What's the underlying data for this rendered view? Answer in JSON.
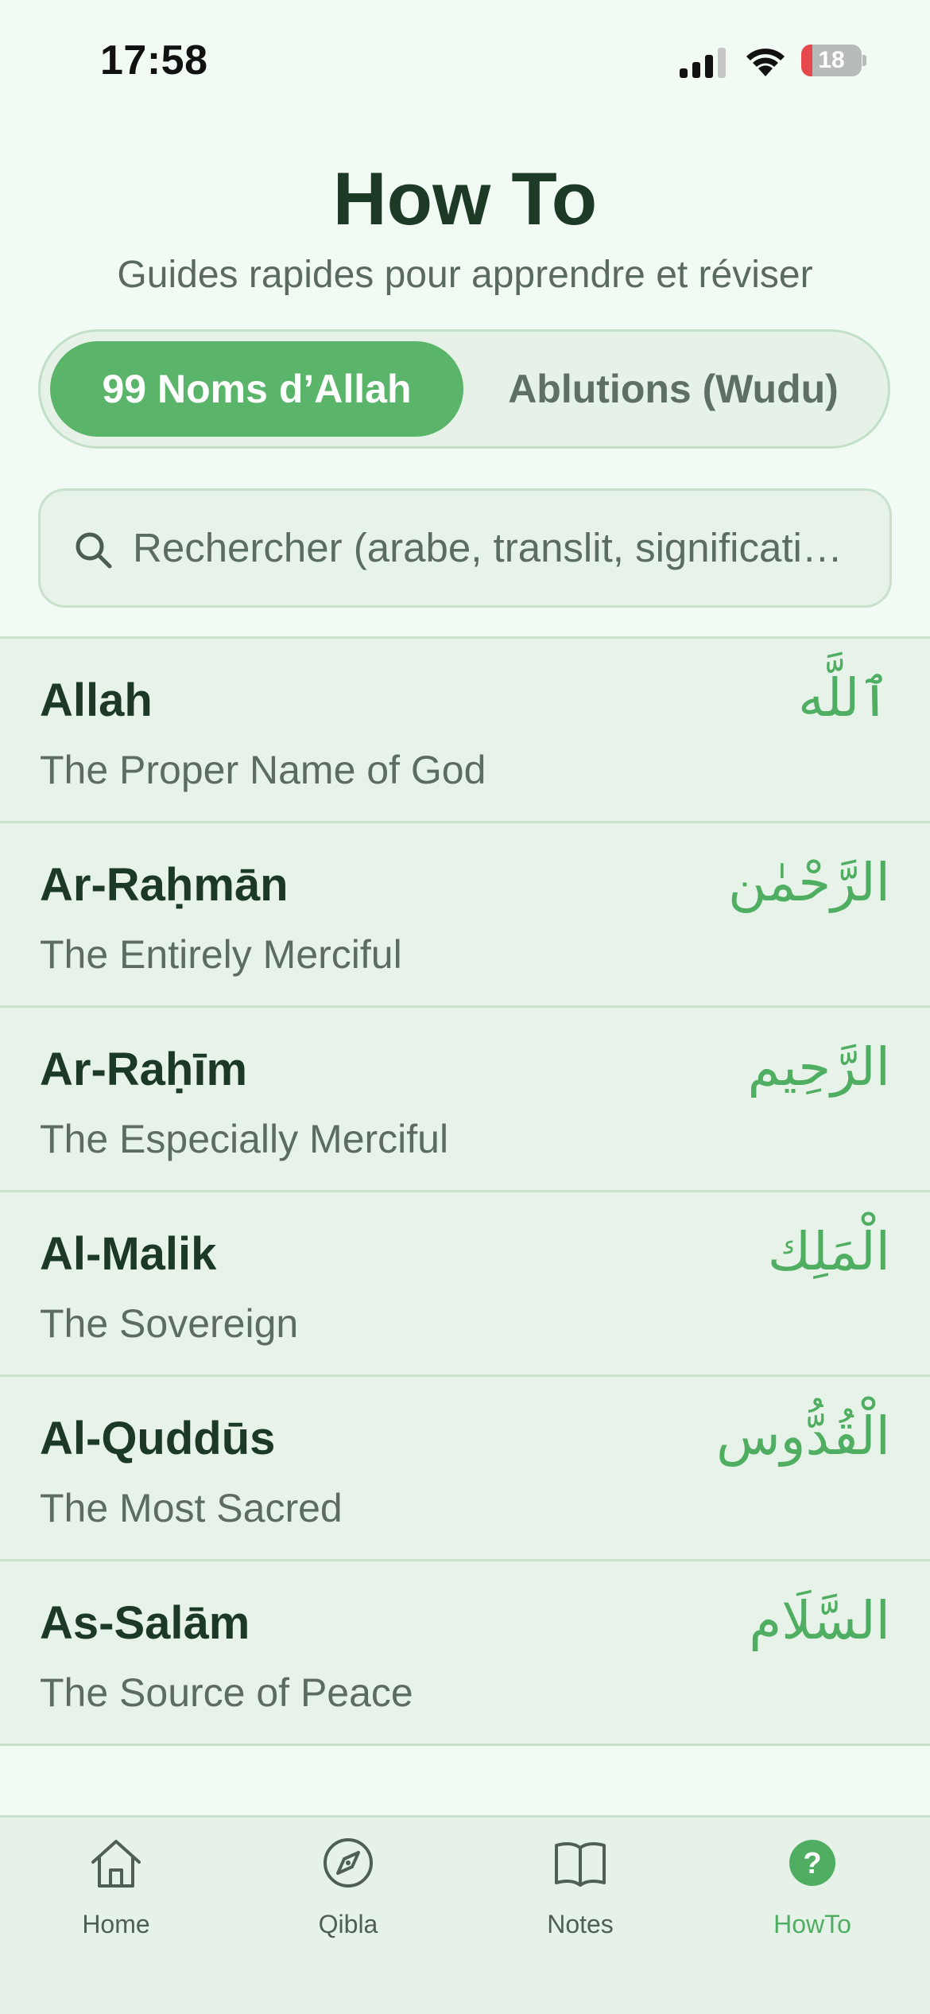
{
  "status_bar": {
    "time": "17:58",
    "battery_level": "18",
    "battery_fraction": 0.18,
    "icons": [
      "cellular-signal-icon",
      "wifi-icon",
      "battery-icon"
    ]
  },
  "header": {
    "title": "How To",
    "subtitle": "Guides rapides pour apprendre et réviser"
  },
  "segments": {
    "active": "99 Noms d’Allah",
    "inactive": "Ablutions (Wudu)"
  },
  "search": {
    "placeholder": "Rechercher (arabe, translit, signification...)",
    "icon": "search-icon"
  },
  "names": [
    {
      "translit": "Allah",
      "meaning": "The Proper Name of God",
      "arabic": "ٱللَّه"
    },
    {
      "translit": "Ar-Raḥmān",
      "meaning": "The Entirely Merciful",
      "arabic": "الرَّحْمٰن"
    },
    {
      "translit": "Ar-Raḥīm",
      "meaning": "The Especially Merciful",
      "arabic": "الرَّحِيم"
    },
    {
      "translit": "Al-Malik",
      "meaning": "The Sovereign",
      "arabic": "الْمَلِك"
    },
    {
      "translit": "Al-Quddūs",
      "meaning": "The Most Sacred",
      "arabic": "الْقُدُّوس"
    },
    {
      "translit": "As-Salām",
      "meaning": "The Source of Peace",
      "arabic": "السَّلَام"
    }
  ],
  "tab_bar": {
    "tabs": [
      {
        "label": "Home",
        "icon": "home-icon"
      },
      {
        "label": "Qibla",
        "icon": "compass-icon"
      },
      {
        "label": "Notes",
        "icon": "book-icon"
      },
      {
        "label": "HowTo",
        "icon": "question-icon"
      }
    ],
    "active": "HowTo"
  },
  "colors": {
    "accent": "#5ab56a",
    "arabic_text": "#4fae61",
    "background": "#f1fbf4",
    "row_background": "#e7f3e9",
    "title_text": "#1d3a26"
  }
}
